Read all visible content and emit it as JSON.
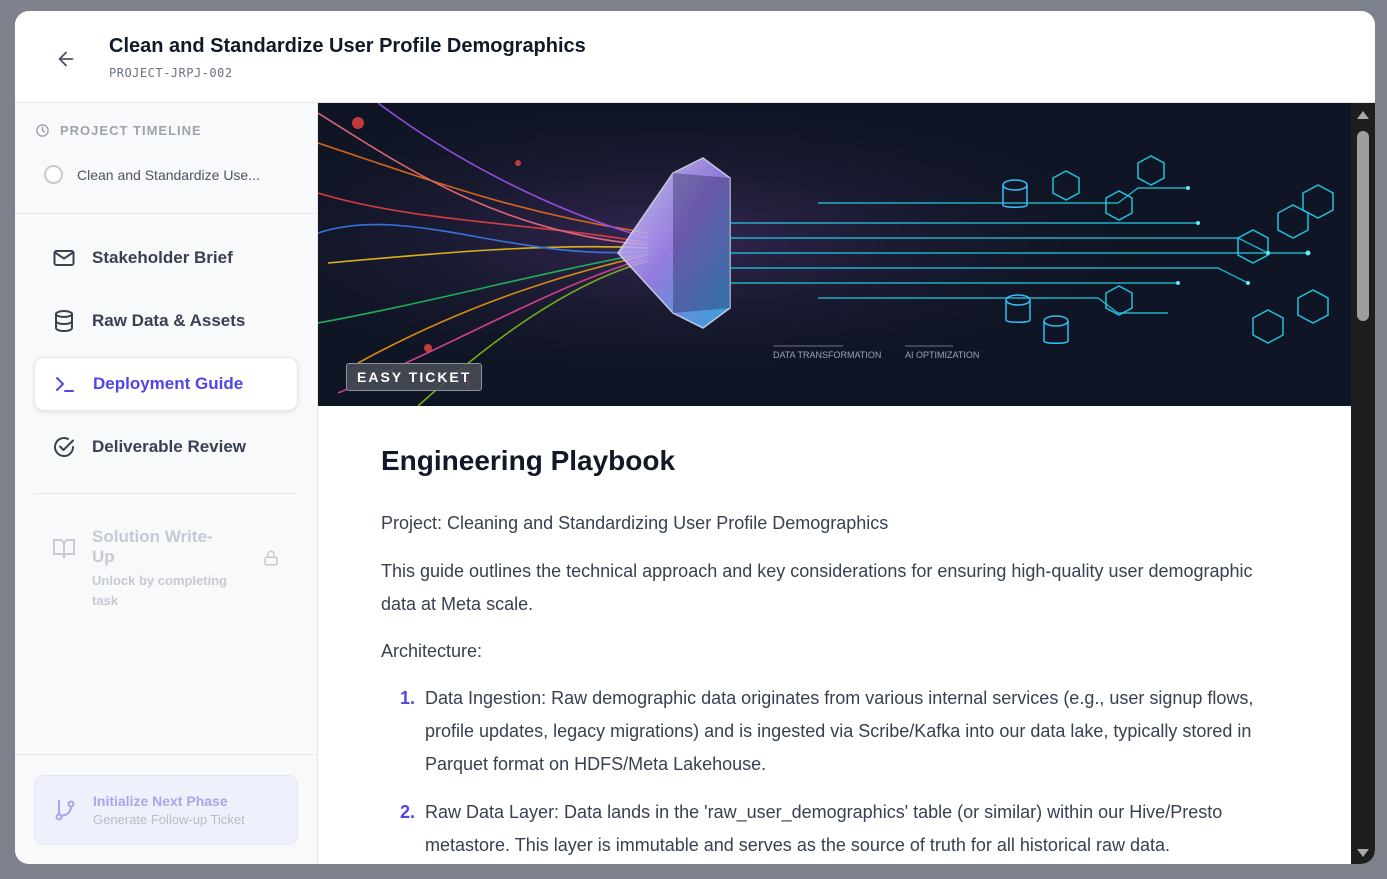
{
  "header": {
    "title": "Clean and Standardize User Profile Demographics",
    "code": "PROJECT-JRPJ-002",
    "back_icon": "arrow-left-icon"
  },
  "sidebar": {
    "timeline_heading": "PROJECT TIMELINE",
    "timeline_item": "Clean and Standardize Use...",
    "nav": [
      {
        "label": "Stakeholder Brief",
        "icon": "mail-icon"
      },
      {
        "label": "Raw Data & Assets",
        "icon": "database-icon"
      },
      {
        "label": "Deployment Guide",
        "icon": "terminal-icon",
        "active": true
      },
      {
        "label": "Deliverable Review",
        "icon": "check-circle-icon"
      }
    ],
    "locked": {
      "title": "Solution Write-Up",
      "subtitle": "Unlock by completing task",
      "icon": "book-icon"
    },
    "footer": {
      "title": "Initialize Next Phase",
      "subtitle": "Generate Follow-up Ticket",
      "icon": "git-branch-icon"
    }
  },
  "banner": {
    "badge": "EASY TICKET",
    "label_left": "DATA TRANSFORMATION",
    "label_right": "AI OPTIMIZATION"
  },
  "content": {
    "heading": "Engineering Playbook",
    "project_line": "Project: Cleaning and Standardizing User Profile Demographics",
    "intro": "This guide outlines the technical approach and key considerations for ensuring high-quality user demographic data at Meta scale.",
    "architecture_label": "Architecture:",
    "list": [
      {
        "num": "1.",
        "text": "Data Ingestion: Raw demographic data originates from various internal services (e.g., user signup flows, profile updates, legacy migrations) and is ingested via Scribe/Kafka into our data lake, typically stored in Parquet format on HDFS/Meta Lakehouse."
      },
      {
        "num": "2.",
        "text": "Raw Data Layer: Data lands in the 'raw_user_demographics' table (or similar) within our Hive/Presto metastore. This layer is immutable and serves as the source of truth for all historical raw data."
      }
    ]
  },
  "colors": {
    "accent": "#4f46e5",
    "banner_bg": "#0f1524"
  }
}
